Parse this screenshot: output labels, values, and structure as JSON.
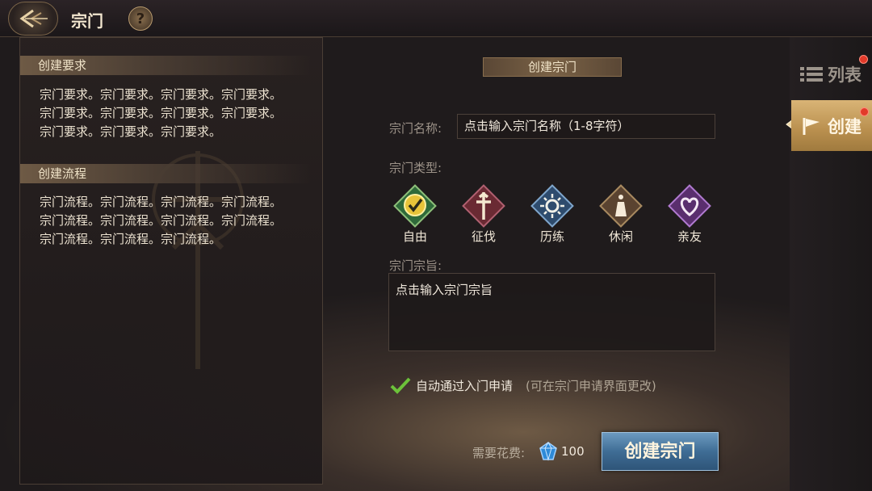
{
  "header": {
    "title": "宗门",
    "help_label": "?"
  },
  "left_panel": {
    "requirements": {
      "title": "创建要求",
      "lines": [
        "宗门要求。宗门要求。宗门要求。宗门要求。",
        "宗门要求。宗门要求。宗门要求。宗门要求。",
        "宗门要求。宗门要求。宗门要求。"
      ]
    },
    "process": {
      "title": "创建流程",
      "lines": [
        "宗门流程。宗门流程。宗门流程。宗门流程。",
        "宗门流程。宗门流程。宗门流程。宗门流程。",
        "宗门流程。宗门流程。宗门流程。"
      ]
    }
  },
  "form": {
    "title": "创建宗门",
    "name_label": "宗门名称:",
    "name_placeholder": "点击输入宗门名称（1-8字符）",
    "type_label": "宗门类型:",
    "types": [
      {
        "label": "自由",
        "icon": "checkmark-icon",
        "color": "#2f6a3a"
      },
      {
        "label": "征伐",
        "icon": "sword-icon",
        "color": "#6a2a33"
      },
      {
        "label": "历练",
        "icon": "sun-icon",
        "color": "#2e4c6e"
      },
      {
        "label": "休闲",
        "icon": "bell-icon",
        "color": "#5a4330"
      },
      {
        "label": "亲友",
        "icon": "heart-icon",
        "color": "#5a2e6e"
      }
    ],
    "goal_label": "宗门宗旨:",
    "goal_placeholder": "点击输入宗门宗旨",
    "auto_approve_label": "自动通过入门申请",
    "auto_approve_checked": true,
    "auto_approve_note": "(可在宗门申请界面更改)",
    "cost_label": "需要花费:",
    "cost_value": "100",
    "create_button": "创建宗门"
  },
  "side_tabs": {
    "list_label": "列表",
    "create_label": "创建"
  },
  "colors": {
    "accent_gold": "#b98f4e",
    "button_blue": "#3f6d95",
    "badge_red": "#e23a2a"
  }
}
